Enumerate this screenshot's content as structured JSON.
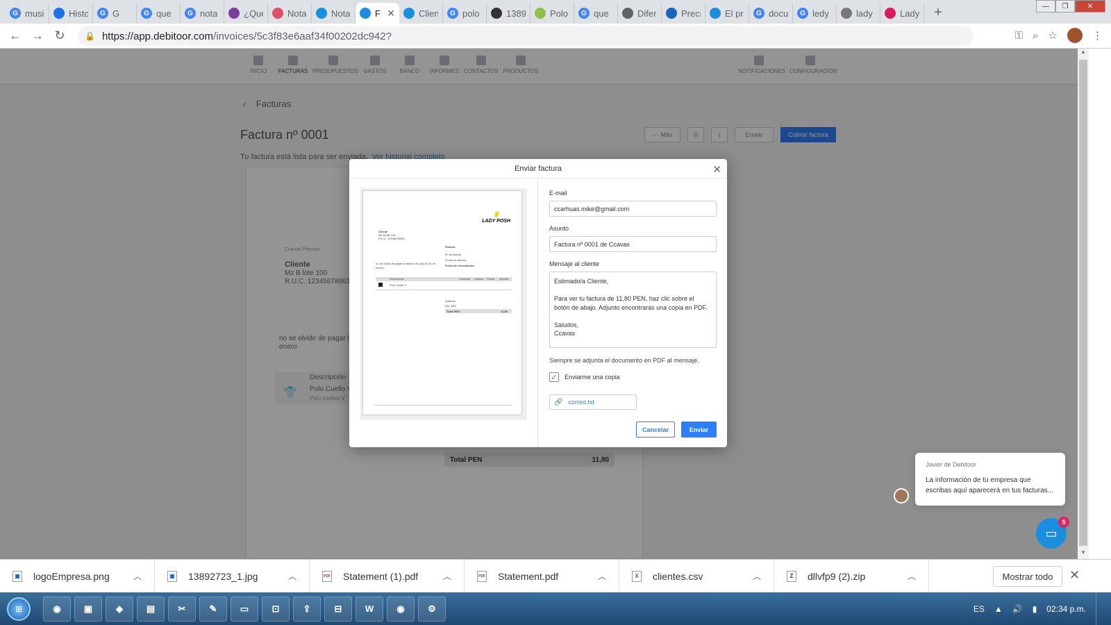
{
  "browser": {
    "tabs": [
      {
        "label": "musi",
        "icon": "google-icon",
        "color": "#4285f4"
      },
      {
        "label": "Histo",
        "icon": "history-icon",
        "color": "#1a73e8"
      },
      {
        "label": "G",
        "icon": "google-icon",
        "color": "#4285f4"
      },
      {
        "label": "que",
        "icon": "google-icon",
        "color": "#4285f4"
      },
      {
        "label": "nota",
        "icon": "google-icon",
        "color": "#4285f4"
      },
      {
        "label": "¿Qué",
        "icon": "site-icon",
        "color": "#7b3fa0"
      },
      {
        "label": "Nota",
        "icon": "site-icon",
        "color": "#e04e6e"
      },
      {
        "label": "Nota",
        "icon": "debitoor-icon",
        "color": "#1a8fe0"
      },
      {
        "label": "F",
        "icon": "debitoor-icon",
        "color": "#1a8fe0",
        "active": true
      },
      {
        "label": "Clien",
        "icon": "debitoor-icon",
        "color": "#1a8fe0"
      },
      {
        "label": "polo",
        "icon": "google-icon",
        "color": "#4285f4"
      },
      {
        "label": "1389",
        "icon": "site-icon",
        "color": "#333333"
      },
      {
        "label": "Polo",
        "icon": "site-icon",
        "color": "#8bc34a"
      },
      {
        "label": "que",
        "icon": "google-icon",
        "color": "#4285f4"
      },
      {
        "label": "Difer",
        "icon": "loading-icon",
        "color": "#5f6368"
      },
      {
        "label": "Preci",
        "icon": "site-icon",
        "color": "#1565c0"
      },
      {
        "label": "El pr",
        "icon": "debitoor-icon",
        "color": "#1a8fe0"
      },
      {
        "label": "docu",
        "icon": "google-icon",
        "color": "#4285f4"
      },
      {
        "label": "ledy",
        "icon": "google-icon",
        "color": "#4285f4"
      },
      {
        "label": "lady",
        "icon": "document-icon",
        "color": "#777777"
      },
      {
        "label": "Lady",
        "icon": "site-icon",
        "color": "#d81b60"
      }
    ],
    "url_host": "https://app.debitoor.com",
    "url_path": "/invoices/5c3f83e6aaf34f00202dc942?"
  },
  "app": {
    "nav": [
      {
        "label": "INICIO"
      },
      {
        "label": "FACTURAS",
        "active": true
      },
      {
        "label": "PRESUPUESTOS"
      },
      {
        "label": "GASTOS"
      },
      {
        "label": "BANCO"
      },
      {
        "label": "INFORMES"
      },
      {
        "label": "CONTACTOS"
      },
      {
        "label": "PRODUCTOS"
      },
      {
        "label": "NOTIFICACIONES"
      },
      {
        "label": "CONFIGURACIÓN"
      }
    ],
    "breadcrumb": "Facturas",
    "title": "Factura nº 0001",
    "status": "Tu factura está lista para ser enviada.",
    "history_link": "Ver historial completo",
    "toolbar": {
      "more": "··· Más",
      "send": "Enviar",
      "collect": "Cobrar factura"
    },
    "background_doc": {
      "company": "Ccavas Preview",
      "client_name": "Cliente",
      "client_address": "Mz B lote 100",
      "client_ruc": "R.U.C. 12345678963",
      "note": "no se olvide de pagar la factura",
      "note2": "enero",
      "desc_header": "Descripción",
      "item": "Polo Cuello V",
      "item_sub": "Polo cuellos V",
      "total_label": "Total PEN",
      "total_value": "11,80"
    }
  },
  "modal": {
    "title": "Enviar factura",
    "email_label": "E-mail",
    "email_value": "ccarhuas.mike@gmail.com",
    "subject_label": "Asunto",
    "subject_value": "Factura nº 0001 de Ccavas",
    "message_label": "Mensaje al cliente",
    "message_lines": [
      "Estimado/a Cliente,",
      "",
      "Para ver tu factura de 11,80 PEN, haz clic sobre el",
      "botón de abajo. Adjunto encontrarás una copia en PDF.",
      "",
      "Saludos,",
      "Ccavas"
    ],
    "pdf_note": "Siempre se adjunta el documento en PDF al mensaje.",
    "copy_label": "Enviarme una copia",
    "copy_checked": true,
    "attachment": "correo.txt",
    "cancel": "Cancelar",
    "send": "Enviar",
    "preview": {
      "logo": "LADY POSH",
      "client": "Cliente",
      "address": "Mz B lote 100",
      "ruc": "R.U.C. 12345678963",
      "invoice_title": "Factura",
      "rows": [
        "Nº de factura",
        "Fecha de factura",
        "Fecha de vencimiento"
      ],
      "note": "no se olvide de pagar la factura de polo (5,15 de enero)",
      "table_cols": [
        "Descripción",
        "Cantidad",
        "Unidad",
        "Precio",
        "Importe"
      ],
      "item": "Polo Cuello V",
      "totals": [
        "Subtotal",
        "IGV 18%",
        "Total PEN"
      ],
      "total_value": "11,80"
    }
  },
  "chat": {
    "from": "Javier de Debitoor",
    "message": "La información de tu empresa que escribas aquí aparecerá en tus facturas...",
    "badge": "5"
  },
  "downloads": {
    "items": [
      {
        "name": "logoEmpresa.png",
        "icon": "image-file-icon"
      },
      {
        "name": "13892723_1.jpg",
        "icon": "image-file-icon"
      },
      {
        "name": "Statement (1).pdf",
        "icon": "pdf-file-icon"
      },
      {
        "name": "Statement.pdf",
        "icon": "pdf-file-icon"
      },
      {
        "name": "clientes.csv",
        "icon": "excel-file-icon"
      },
      {
        "name": "dllvfp9 (2).zip",
        "icon": "zip-file-icon"
      }
    ],
    "show_all": "Mostrar todo"
  },
  "taskbar": {
    "lang": "ES",
    "time": "02:34 p.m."
  }
}
